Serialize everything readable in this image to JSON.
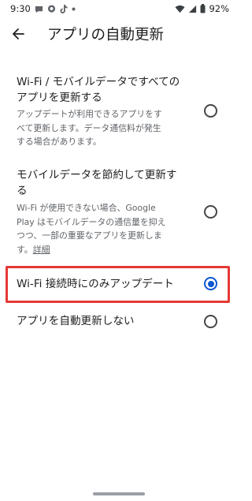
{
  "status_bar": {
    "time": "9:30",
    "battery": "92%",
    "icons": [
      "message-bubble-icon",
      "chat-bubble-icon",
      "tiktok-icon",
      "dot-icon",
      "wifi-icon",
      "signal-icon",
      "battery-icon"
    ]
  },
  "header": {
    "title": "アプリの自動更新",
    "back_icon": "arrow-back-icon"
  },
  "options": [
    {
      "title_lines": [
        "Wi-Fi / モバイルデータですべての",
        "アプリを更新する"
      ],
      "desc_lines": [
        "アップデートが利用できるアプリをす",
        "べて更新します。データ通信料が発生",
        "する場合があります。"
      ],
      "selected": false
    },
    {
      "title_lines": [
        "モバイルデータを節約して更新す",
        "る"
      ],
      "desc_lines": [
        "Wi-Fi が使用できない場合、Google",
        "Play はモバイルデータの通信量を抑え",
        "つつ、一部の重要なアプリを更新しま",
        "す。"
      ],
      "desc_link": "詳細",
      "selected": false
    },
    {
      "title_lines": [
        "Wi-Fi 接続時にのみアップデート"
      ],
      "selected": true,
      "highlighted": true
    },
    {
      "title_lines": [
        "アプリを自動更新しない"
      ],
      "selected": false
    }
  ],
  "colors": {
    "accent": "#0b57d0",
    "highlight_box": "#e53935",
    "text_primary": "#1f1f1f",
    "text_secondary": "#5f6368"
  }
}
